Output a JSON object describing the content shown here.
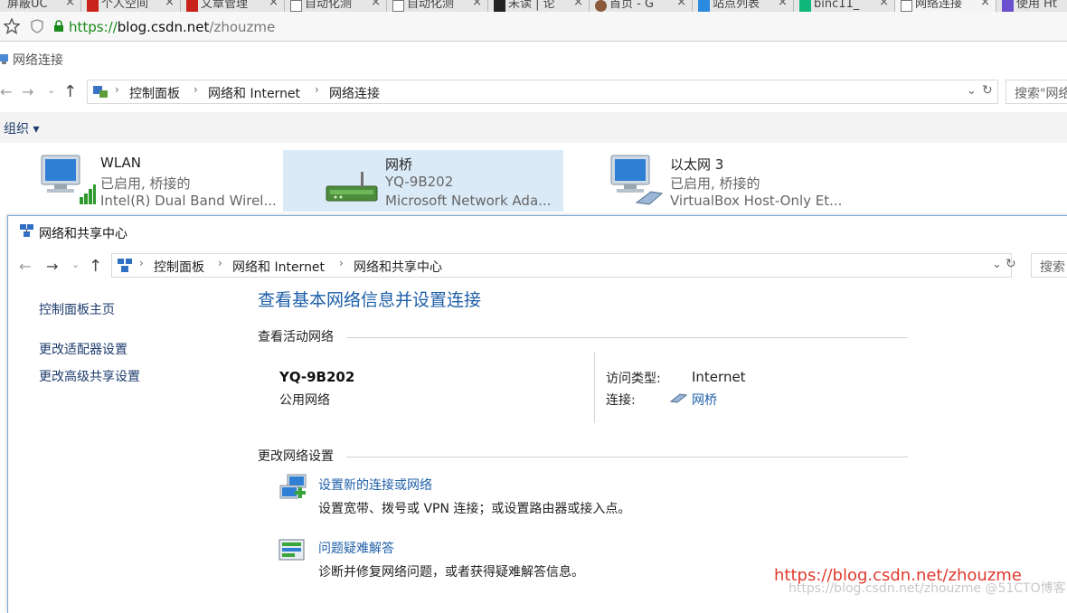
{
  "browser": {
    "tabs": [
      {
        "label": "屏蔽UC"
      },
      {
        "label": "个人空间"
      },
      {
        "label": "文章管理"
      },
      {
        "label": "自动化测"
      },
      {
        "label": "自动化测"
      },
      {
        "label": "未读 | 论"
      },
      {
        "label": "首页 - G"
      },
      {
        "label": "站点列表"
      },
      {
        "label": "binc11_"
      },
      {
        "label": "网络连接"
      },
      {
        "label": "使用 Ht"
      }
    ],
    "tab_close": "×",
    "url": {
      "scheme": "https://",
      "host": "blog.csdn.net",
      "path": "/zhouzme"
    }
  },
  "explorer": {
    "title": "网络连接",
    "breadcrumb": [
      "控制面板",
      "网络和 Internet",
      "网络连接"
    ],
    "search_placeholder": "搜索\"网络",
    "organize_label": "组织 ▾",
    "adapters": [
      {
        "name": "WLAN",
        "status": "已启用, 桥接的",
        "device": "Intel(R) Dual Band Wirel..."
      },
      {
        "name": "网桥",
        "status": "YQ-9B202",
        "device": "Microsoft Network Ada..."
      },
      {
        "name": "以太网 3",
        "status": "已启用, 桥接的",
        "device": "VirtualBox Host-Only Et..."
      }
    ]
  },
  "nsc": {
    "title": "网络和共享中心",
    "breadcrumb": [
      "控制面板",
      "网络和 Internet",
      "网络和共享中心"
    ],
    "search_placeholder": "搜索",
    "sidebar": {
      "home": "控制面板主页",
      "adapter_settings": "更改适配器设置",
      "sharing_settings": "更改高级共享设置"
    },
    "heading": "查看基本网络信息并设置连接",
    "active_section": "查看活动网络",
    "network": {
      "name": "YQ-9B202",
      "type": "公用网络",
      "access_label": "访问类型:",
      "access_value": "Internet",
      "connection_label": "连接:",
      "connection_value": "网桥"
    },
    "change_section": "更改网络设置",
    "tasks": [
      {
        "title": "设置新的连接或网络",
        "desc": "设置宽带、拨号或 VPN 连接；或设置路由器或接入点。"
      },
      {
        "title": "问题疑难解答",
        "desc": "诊断并修复网络问题，或者获得疑难解答信息。"
      }
    ]
  },
  "watermark": {
    "red": "https://blog.csdn.net/zhouzme",
    "grey": "https://blog.csdn.net/zhouzme @51CTO博客"
  },
  "colors": {
    "link": "#1e5fa8",
    "watermark": "#e03a2e",
    "selected": "#dbeaf7"
  }
}
